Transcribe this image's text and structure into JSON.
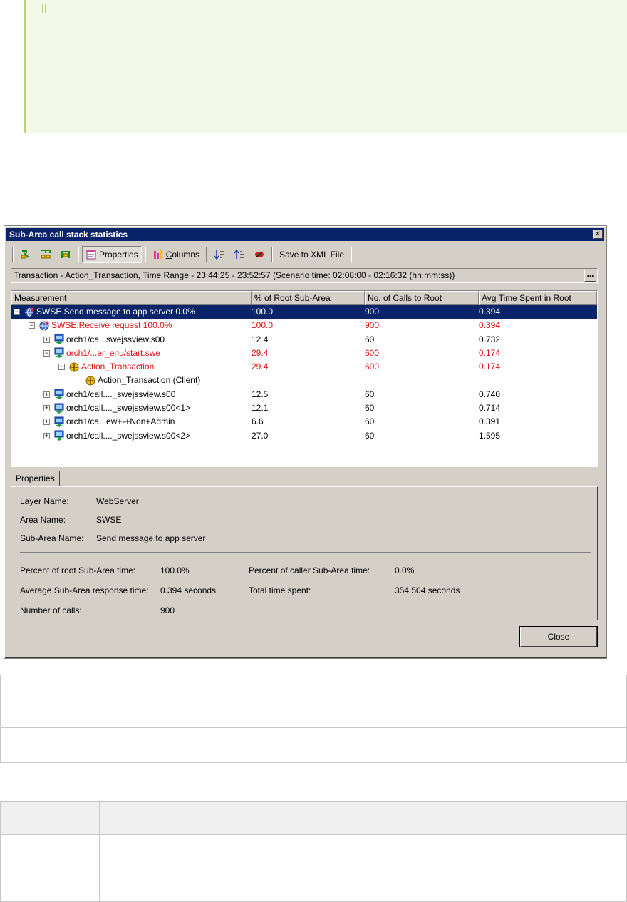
{
  "dialog": {
    "title": "Sub-Area call stack statistics",
    "close_glyph": "✕",
    "toolbar": {
      "properties_label": "Properties",
      "columns_label": "Columns",
      "save_label": "Save to XML File"
    },
    "range_text": "Transaction - Action_Transaction, Time Range - 23:44:25 - 23:52:57 (Scenario time: 02:08:00 - 02:16:32 (hh:mm:ss))",
    "range_button": "...",
    "columns": [
      "Measurement",
      "% of Root Sub-Area",
      "No. of Calls to Root",
      "Avg Time Spent in Root"
    ],
    "rows": [
      {
        "name": "SWSE.Send message to app server  0.0%",
        "pct": "100.0",
        "calls": "900",
        "avg": "0.394",
        "level": 0,
        "exp": "−",
        "icon": "globe-icon",
        "state": "sel"
      },
      {
        "name": "SWSE.Receive request  100.0%",
        "pct": "100.0",
        "calls": "900",
        "avg": "0.394",
        "level": 1,
        "exp": "−",
        "icon": "globe-icon",
        "state": "hot"
      },
      {
        "name": "orch1/ca...swejssview.s00",
        "pct": "12.4",
        "calls": "60",
        "avg": "0.732",
        "level": 2,
        "exp": "+",
        "icon": "server-icon",
        "state": ""
      },
      {
        "name": "orch1/...er_enu/start.swe",
        "pct": "29.4",
        "calls": "600",
        "avg": "0.174",
        "level": 2,
        "exp": "−",
        "icon": "server-icon",
        "state": "hot"
      },
      {
        "name": "Action_Transaction",
        "pct": "29.4",
        "calls": "600",
        "avg": "0.174",
        "level": 3,
        "exp": "−",
        "icon": "transaction-icon",
        "state": "hot"
      },
      {
        "name": "Action_Transaction (Client)",
        "pct": "",
        "calls": "",
        "avg": "",
        "level": 4,
        "exp": "",
        "icon": "transaction-icon",
        "state": ""
      },
      {
        "name": "orch1/call...._swejssview.s00",
        "pct": "12.5",
        "calls": "60",
        "avg": "0.740",
        "level": 2,
        "exp": "+",
        "icon": "server-icon",
        "state": ""
      },
      {
        "name": "orch1/call...._swejssview.s00<1>",
        "pct": "12.1",
        "calls": "60",
        "avg": "0.714",
        "level": 2,
        "exp": "+",
        "icon": "server-icon",
        "state": ""
      },
      {
        "name": "orch1/ca...ew+-+Non+Admin",
        "pct": "6.6",
        "calls": "60",
        "avg": "0.391",
        "level": 2,
        "exp": "+",
        "icon": "server-icon",
        "state": ""
      },
      {
        "name": "orch1/call...._swejssview.s00<2>",
        "pct": "27.0",
        "calls": "60",
        "avg": "1.595",
        "level": 2,
        "exp": "+",
        "icon": "server-icon",
        "state": ""
      }
    ],
    "properties_tab": "Properties",
    "props": {
      "layer_label": "Layer Name:",
      "layer_value": "WebServer",
      "area_label": "Area Name:",
      "area_value": "SWSE",
      "subarea_label": "Sub-Area Name:",
      "subarea_value": "Send message to app server",
      "pct_root_label": "Percent of root Sub-Area time:",
      "pct_root_value": "100.0%",
      "pct_caller_label": "Percent of caller Sub-Area time:",
      "pct_caller_value": "0.0%",
      "avg_label": "Average Sub-Area response time:",
      "avg_value": "0.394 seconds",
      "total_label": "Total time spent:",
      "total_value": "354.504 seconds",
      "calls_label": "Number of calls:",
      "calls_value": "900"
    },
    "close_label": "Close"
  },
  "colors": {
    "selection": "#0a246a",
    "hot_text": "#e01010",
    "note_bg": "#f3f8e9",
    "note_border": "#b5d479"
  }
}
